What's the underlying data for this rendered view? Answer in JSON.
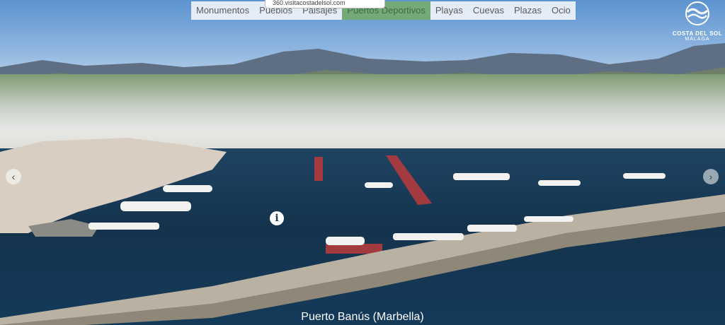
{
  "nav": {
    "items": [
      "Monumentos",
      "Pueblos",
      "Paisajes",
      "Puertos Deportivos",
      "Playas",
      "Cuevas",
      "Plazas",
      "Ocio"
    ],
    "active_index": 3
  },
  "url_tooltip": "360.visitacostadelsol.com",
  "logo": {
    "name": "COSTA DEL SOL",
    "subtitle": "MÁLAGA"
  },
  "info_label": "i",
  "caption": "Puerto Banús (Marbella)",
  "icons": {
    "prev": "chevron-left-icon",
    "next": "chevron-right-icon",
    "info": "info-icon",
    "logo": "wave-logo-icon"
  },
  "colors": {
    "active_tab": "#74a978",
    "sea": "#14334d",
    "caption_text": "#ffffff"
  }
}
